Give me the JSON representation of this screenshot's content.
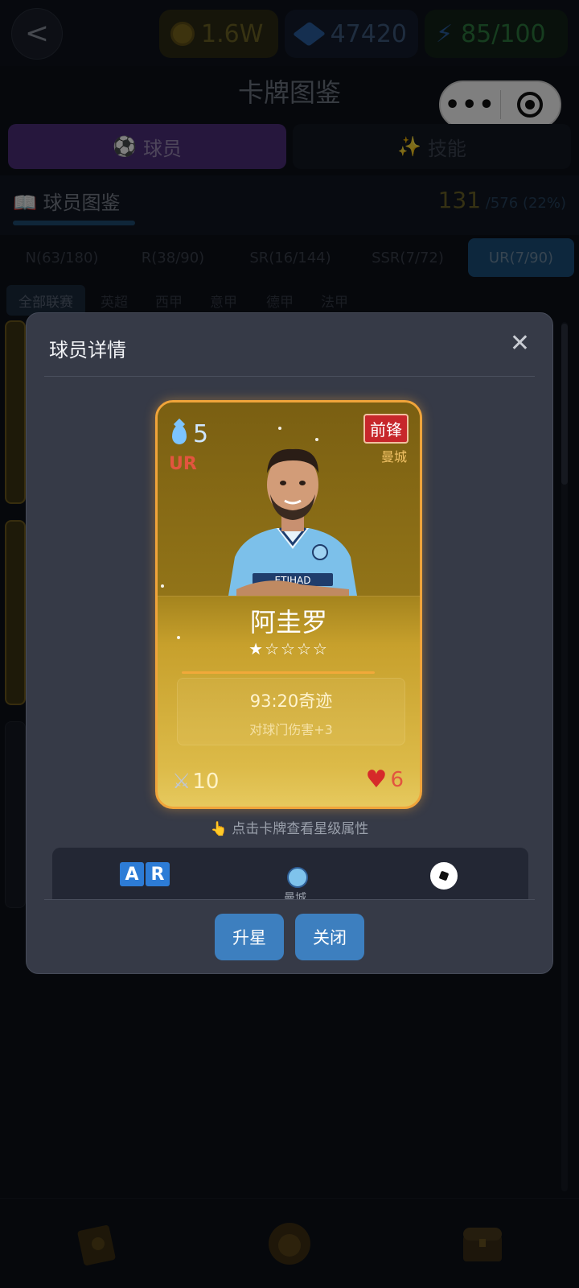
{
  "topbar": {
    "back_label": "<",
    "coins": "1.6W",
    "gems": "47420",
    "energy": "85/100"
  },
  "page_title": "卡牌图鉴",
  "main_tabs": [
    {
      "icon": "⚽",
      "label": "球员"
    },
    {
      "icon": "✨",
      "label": "技能"
    }
  ],
  "section": {
    "icon": "📖",
    "title": "球员图鉴",
    "collected": "131",
    "total": "/576",
    "percent": "(22%)"
  },
  "rarity_tabs": [
    "N(63/180)",
    "R(38/90)",
    "SR(16/144)",
    "SSR(7/72)",
    "UR(7/90)"
  ],
  "active_rarity": "UR(7/90)",
  "league_tabs": [
    "全部联赛",
    "英超",
    "西甲",
    "意甲",
    "德甲",
    "法甲"
  ],
  "modal": {
    "title": "球员详情",
    "close_icon": "✕",
    "card": {
      "cost": "5",
      "rarity": "UR",
      "position": "前锋",
      "club": "曼城",
      "name": "阿圭罗",
      "stars": "★☆☆☆☆",
      "star_level": 1,
      "skill_name": "93:20奇迹",
      "skill_desc": "对球门伤害+3",
      "attack": "10",
      "hp": "6"
    },
    "tap_hint_icon": "👆",
    "tap_hint": "点击卡牌查看星级属性",
    "info_strip": {
      "ar_letters": [
        "A",
        "R"
      ],
      "club_label": "曼城"
    },
    "buttons": {
      "upgrade": "升星",
      "close": "关闭"
    }
  },
  "colors": {
    "accent_purple": "#4d2f7a",
    "accent_blue": "#3d7fbf",
    "card_gold": "#dcba48",
    "card_border": "#f0a43a",
    "rarity_red": "#e2553f"
  }
}
